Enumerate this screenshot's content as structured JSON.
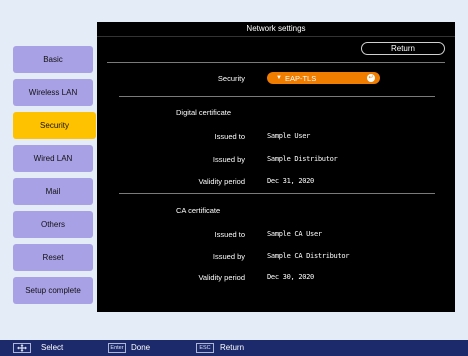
{
  "window": {
    "title": "Network settings"
  },
  "sidebar": {
    "items": [
      {
        "label": "Basic"
      },
      {
        "label": "Wireless LAN"
      },
      {
        "label": "Security"
      },
      {
        "label": "Wired LAN"
      },
      {
        "label": "Mail"
      },
      {
        "label": "Others"
      },
      {
        "label": "Reset"
      },
      {
        "label": "Setup complete"
      }
    ],
    "active_index": 2
  },
  "main": {
    "return_label": "Return",
    "security": {
      "label": "Security",
      "value": "EAP-TLS"
    },
    "digital_certificate": {
      "title": "Digital certificate",
      "issued_to_label": "Issued to",
      "issued_to": "Sample User",
      "issued_by_label": "Issued by",
      "issued_by": "Sample Distributor",
      "validity_label": "Validity period",
      "validity": "Dec 31, 2020"
    },
    "ca_certificate": {
      "title": "CA certificate",
      "issued_to_label": "Issued to",
      "issued_to": "Sample CA User",
      "issued_by_label": "Issued by",
      "issued_by": "Sample CA Distributor",
      "validity_label": "Validity period",
      "validity": "Dec 30, 2020"
    }
  },
  "bottom_bar": {
    "select_label": "Select",
    "enter_key": "Enter",
    "done_label": "Done",
    "esc_key": "ESC",
    "return_label": "Return"
  },
  "colors": {
    "sidebar_button": "#a9a1e6",
    "sidebar_active": "#ffc200",
    "panel_bg": "#000000",
    "select_accent": "#f07c00",
    "bottom_bar": "#1c2a6b",
    "page_bg": "#e4ecf8"
  },
  "icons": {
    "select_key": "four-way-arrow-icon",
    "dropdown": "triangle-down-icon",
    "enter": "enter-circle-icon"
  }
}
